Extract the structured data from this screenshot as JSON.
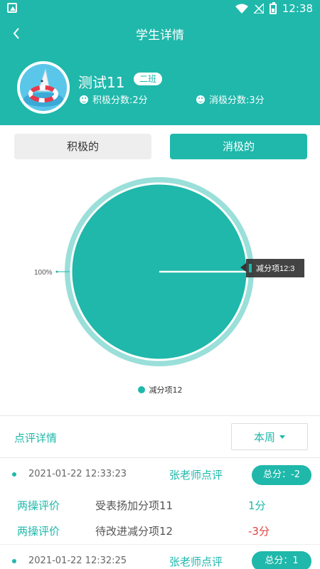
{
  "statusbar": {
    "time": "12:38"
  },
  "header": {
    "title": "学生详情"
  },
  "profile": {
    "name": "测试11",
    "class_badge": "二班",
    "positive_score": "积极分数:2分",
    "negative_score": "消极分数:3分"
  },
  "tabs": [
    {
      "label": "积极的",
      "active": false
    },
    {
      "label": "消极的",
      "active": true
    }
  ],
  "chart_data": {
    "type": "pie",
    "categories": [
      "减分项12"
    ],
    "values": [
      3
    ],
    "percent_label": "100%",
    "tooltip": "减分项12:3",
    "legend": [
      "减分项12"
    ],
    "legend_placement": "bottom",
    "colors": {
      "slice": "#1fb8ab",
      "ring": "#9adfd9"
    }
  },
  "review": {
    "title": "点评详情",
    "period": "本周",
    "records": [
      {
        "time": "2021-01-22 12:33:23",
        "teacher": "张老师点评",
        "total": "总分：-2",
        "items": [
          {
            "type": "两操评价",
            "name": "受表扬加分项11",
            "score": "1分",
            "sign": "pos"
          },
          {
            "type": "两操评价",
            "name": "待改进减分项12",
            "score": "-3分",
            "sign": "neg"
          }
        ]
      },
      {
        "time": "2021-01-22 12:32:25",
        "teacher": "张老师点评",
        "total": "总分：1",
        "items": []
      }
    ]
  },
  "colors": {
    "accent": "#1fb8ab",
    "negative": "#e04040"
  }
}
